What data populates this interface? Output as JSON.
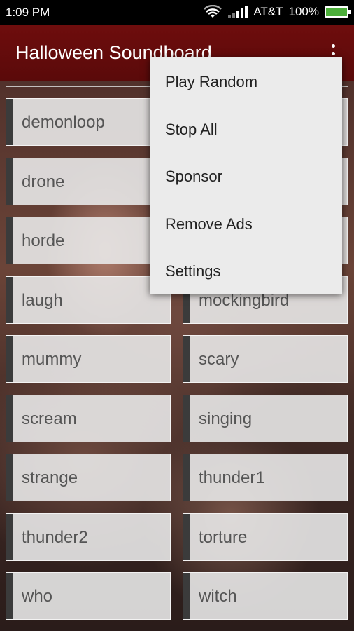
{
  "status_bar": {
    "time": "1:09 PM",
    "carrier": "AT&T",
    "battery": "100%",
    "icons": [
      "wifi-icon",
      "signal-icon",
      "battery-icon"
    ],
    "battery_color": "#4caf3a"
  },
  "action_bar": {
    "title": "Halloween Soundboard",
    "background": "#6e0d0d",
    "overflow_icon": "overflow-menu-icon"
  },
  "sounds": [
    "demonloop",
    "",
    "drone",
    "",
    "horde",
    "",
    "laugh",
    "mockingbird",
    "mummy",
    "scary",
    "scream",
    "singing",
    "strange",
    "thunder1",
    "thunder2",
    "torture",
    "who",
    "witch"
  ],
  "menu": {
    "items": [
      "Play Random",
      "Stop All",
      "Sponsor",
      "Remove Ads",
      "Settings"
    ]
  }
}
